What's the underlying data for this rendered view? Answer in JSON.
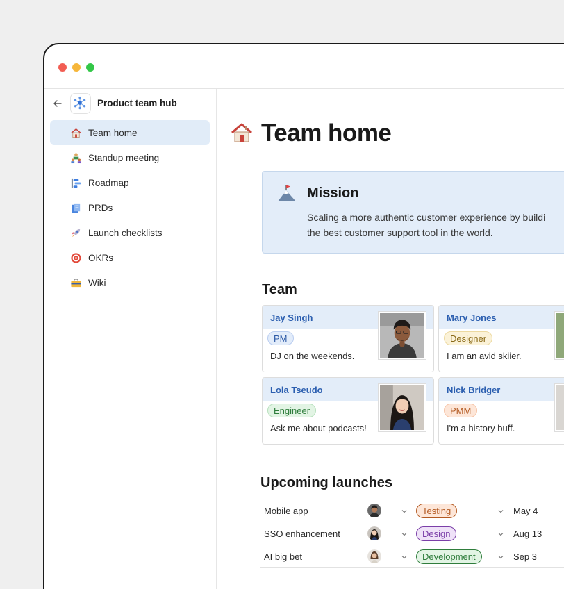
{
  "sidebar": {
    "hub_title": "Product team hub",
    "items": [
      {
        "label": "Team home",
        "icon": "house-icon",
        "active": true
      },
      {
        "label": "Standup meeting",
        "icon": "standup-icon",
        "active": false
      },
      {
        "label": "Roadmap",
        "icon": "roadmap-icon",
        "active": false
      },
      {
        "label": "PRDs",
        "icon": "document-icon",
        "active": false
      },
      {
        "label": "Launch checklists",
        "icon": "rocket-icon",
        "active": false
      },
      {
        "label": "OKRs",
        "icon": "target-icon",
        "active": false
      },
      {
        "label": "Wiki",
        "icon": "toolbox-icon",
        "active": false
      }
    ]
  },
  "page": {
    "title": "Team home"
  },
  "mission": {
    "title": "Mission",
    "text_line1": "Scaling a more authentic customer experience by buildi",
    "text_line2": "the best customer support tool in the world."
  },
  "team": {
    "title": "Team",
    "members": [
      {
        "name": "Jay Singh",
        "role": "PM",
        "role_color": "blue",
        "bio": "DJ on the weekends."
      },
      {
        "name": "Mary Jones",
        "role": "Designer",
        "role_color": "yellow",
        "bio": "I am an avid skiier."
      },
      {
        "name": "Lola Tseudo",
        "role": "Engineer",
        "role_color": "green",
        "bio": "Ask me about podcasts!"
      },
      {
        "name": "Nick Bridger",
        "role": "PMM",
        "role_color": "orange",
        "bio": "I'm a history buff."
      }
    ]
  },
  "launches": {
    "title": "Upcoming launches",
    "rows": [
      {
        "name": "Mobile app",
        "status": "Testing",
        "status_color": "orange",
        "date": "May 4"
      },
      {
        "name": "SSO enhancement",
        "status": "Design",
        "status_color": "purple",
        "date": "Aug 13"
      },
      {
        "name": "AI big bet",
        "status": "Development",
        "status_color": "green",
        "date": "Sep 3"
      }
    ]
  },
  "colors": {
    "accent": "#2c5fb0",
    "active_nav_bg": "#e1ecf8",
    "mission_bg": "#e3edf9"
  }
}
